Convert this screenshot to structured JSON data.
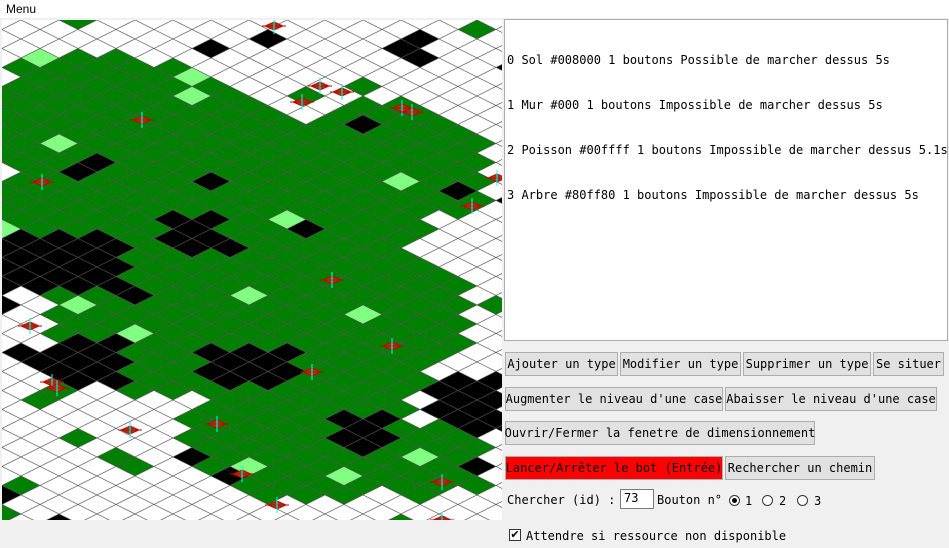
{
  "menubar": {
    "menu_label": "Menu"
  },
  "colors": {
    "sol": "#008000",
    "mur": "#000000",
    "poisson": "#00ffff",
    "arbre": "#80ff80",
    "grid_line": "#555555",
    "empty": "#ffffff",
    "marker": "#cc0000",
    "marker_fill": "#8b4513"
  },
  "type_list": [
    "0 Sol #008000 1 boutons Possible de marcher dessus 5s",
    "1 Mur #000 1 boutons Impossible de marcher dessus 5s",
    "2 Poisson #00ffff 1 boutons Impossible de marcher dessus 5.1s",
    "3 Arbre #80ff80 1 boutons Impossible de marcher dessus 5s"
  ],
  "buttons": {
    "add_type": "Ajouter un type",
    "edit_type": "Modifier un type",
    "delete_type": "Supprimer un type",
    "locate": "Se situer",
    "raise_cell": "Augmenter le niveau d'une case",
    "lower_cell": "Abaisser le niveau d'une case",
    "toggle_resize": "Ouvrir/Fermer la fenetre de dimensionnement",
    "start_stop_bot": "Lancer/Arrêter le bot (Entrée)",
    "find_path": "Rechercher un chemin"
  },
  "search": {
    "label": "Chercher (id) :",
    "value": "73",
    "button_label": "Bouton n°",
    "options": [
      "1",
      "2",
      "3"
    ],
    "selected": "1"
  },
  "wait_option": {
    "label": "Attendre si ressource non disponible",
    "checked": true,
    "check_glyph": "✔"
  }
}
